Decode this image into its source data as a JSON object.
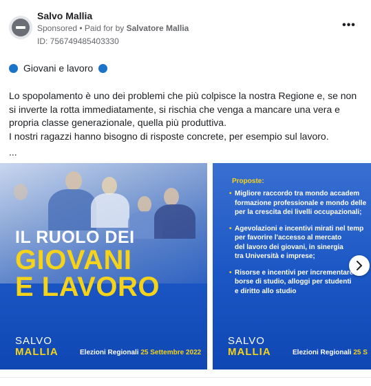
{
  "post": {
    "page_name": "Salvo Mallia",
    "sponsored_label": "Sponsored",
    "separator": " • ",
    "paid_for_prefix": "Paid for by ",
    "payer": "Salvatore Mallia",
    "ad_id": "ID: 756749485403330",
    "more_label": "•••",
    "headline": "Giovani e lavoro",
    "body": [
      "Lo spopolamento è uno dei problemi che più colpisce la nostra Regione e, se non si inverte la rotta immediatamente, si rischia che venga a mancare una vera e propria classe generazionale, quella più produttiva.",
      "I nostri ragazzi hanno bisogno di risposte concrete, per esempio sul lavoro."
    ],
    "ellipsis": "..."
  },
  "carousel": {
    "slide1": {
      "title_small": "IL RUOLO DEI",
      "title_big_line1": "GIOVANI",
      "title_big_line2": "E LAVORO",
      "brand_first": "SALVO",
      "brand_last": "MALLIA",
      "election_text": "Elezioni Regionali ",
      "election_date": "25 Settembre 2022"
    },
    "slide2": {
      "label": "Proposte:",
      "bullet": "•",
      "items": [
        [
          "Migliore raccordo tra mondo accadem",
          "formazione professionale e mondo delle",
          "per la crescita dei livelli occupazionali;"
        ],
        [
          "Agevolazioni e incentivi mirati nel temp",
          "per favorire l'accesso al mercato",
          "del lavoro dei giovani, in sinergia",
          "tra Università e imprese;"
        ],
        [
          "Risorse e incentivi per incrementare",
          "borse di studio, alloggi per studenti",
          "e diritto allo studio"
        ]
      ],
      "brand_first": "SALVO",
      "brand_last": "MALLIA",
      "election_text": "Elezioni Regionali ",
      "election_date": "25 S"
    },
    "next_icon": "chevron-right-icon"
  },
  "colors": {
    "accent_blue": "#1a73c8",
    "brand_yellow": "#f5d31a",
    "slide_blue": "#1a56c4"
  }
}
